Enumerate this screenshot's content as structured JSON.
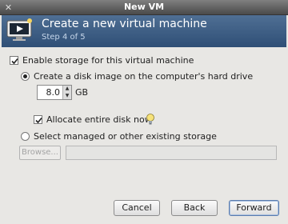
{
  "window": {
    "title": "New VM"
  },
  "banner": {
    "heading": "Create a new virtual machine",
    "step": "Step 4 of 5"
  },
  "storage": {
    "enable_label": "Enable storage for this virtual machine",
    "enable_checked": true,
    "create_image_label": "Create a disk image on the computer's hard drive",
    "create_image_selected": true,
    "size_value": "8.0",
    "size_unit": "GB",
    "allocate_label": "Allocate entire disk now",
    "allocate_checked": true,
    "existing_label": "Select managed or other existing storage",
    "existing_selected": false,
    "browse_label": "Browse...",
    "path_value": ""
  },
  "buttons": {
    "cancel": "Cancel",
    "back": "Back",
    "forward": "Forward"
  },
  "icons": {
    "close": "close-icon",
    "vm": "vm-monitor-icon",
    "info": "lightbulb-icon"
  }
}
